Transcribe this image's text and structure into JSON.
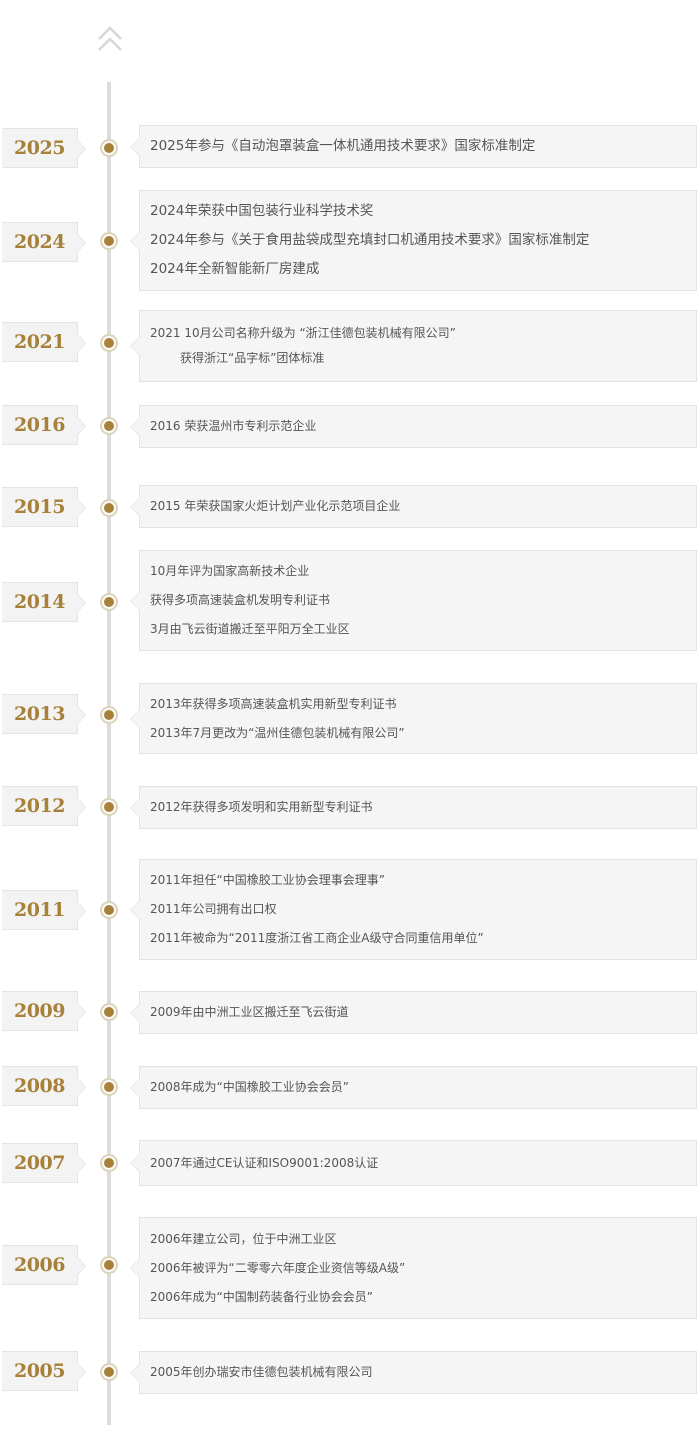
{
  "nav": {
    "back_to_top_icon": "double-chevron-up-icon"
  },
  "colors": {
    "accent": "#a7813a",
    "axis": "#dcdcdc",
    "box_bg": "#f5f5f5",
    "tab_bg": "#f3f3f3",
    "text": "#555555"
  },
  "timeline": [
    {
      "year": "2025",
      "events": [
        "2025年参与《自动泡罩装盒一体机通用技术要求》国家标准制定"
      ]
    },
    {
      "year": "2024",
      "events": [
        "2024年荣获中国包装行业科学技术奖",
        "2024年参与《关于食用盐袋成型充填封口机通用技术要求》国家标准制定",
        "2024年全新智能新厂房建成"
      ]
    },
    {
      "year": "2021",
      "events": [
        "2021 10月公司名称升级为 “浙江佳德包装机械有限公司”",
        "获得浙江“品字标”团体标准"
      ]
    },
    {
      "year": "2016",
      "events": [
        "2016 荣获温州市专利示范企业"
      ]
    },
    {
      "year": "2015",
      "events": [
        "2015 年荣获国家火炬计划产业化示范项目企业"
      ]
    },
    {
      "year": "2014",
      "events": [
        "10月年评为国家高新技术企业",
        "获得多项高速装盒机发明专利证书",
        "3月由飞云街道搬迁至平阳万全工业区"
      ]
    },
    {
      "year": "2013",
      "events": [
        "2013年获得多项高速装盒机实用新型专利证书",
        "2013年7月更改为“温州佳德包装机械有限公司”"
      ]
    },
    {
      "year": "2012",
      "events": [
        "2012年获得多项发明和实用新型专利证书"
      ]
    },
    {
      "year": "2011",
      "events": [
        "2011年担任“中国橡胶工业协会理事会理事”",
        "2011年公司拥有出口权",
        "2011年被命为“2011度浙江省工商企业A级守合同重信用单位”"
      ]
    },
    {
      "year": "2009",
      "events": [
        "2009年由中洲工业区搬迁至飞云街道"
      ]
    },
    {
      "year": "2008",
      "events": [
        "2008年成为“中国橡胶工业协会会员”"
      ]
    },
    {
      "year": "2007",
      "events": [
        "2007年通过CE认证和ISO9001:2008认证"
      ]
    },
    {
      "year": "2006",
      "events": [
        "2006年建立公司，位于中洲工业区",
        "2006年被评为“二零零六年度企业资信等级A级”",
        "2006年成为“中国制药装备行业协会会员”"
      ]
    },
    {
      "year": "2005",
      "events": [
        "2005年创办瑞安市佳德包装机械有限公司"
      ]
    }
  ]
}
